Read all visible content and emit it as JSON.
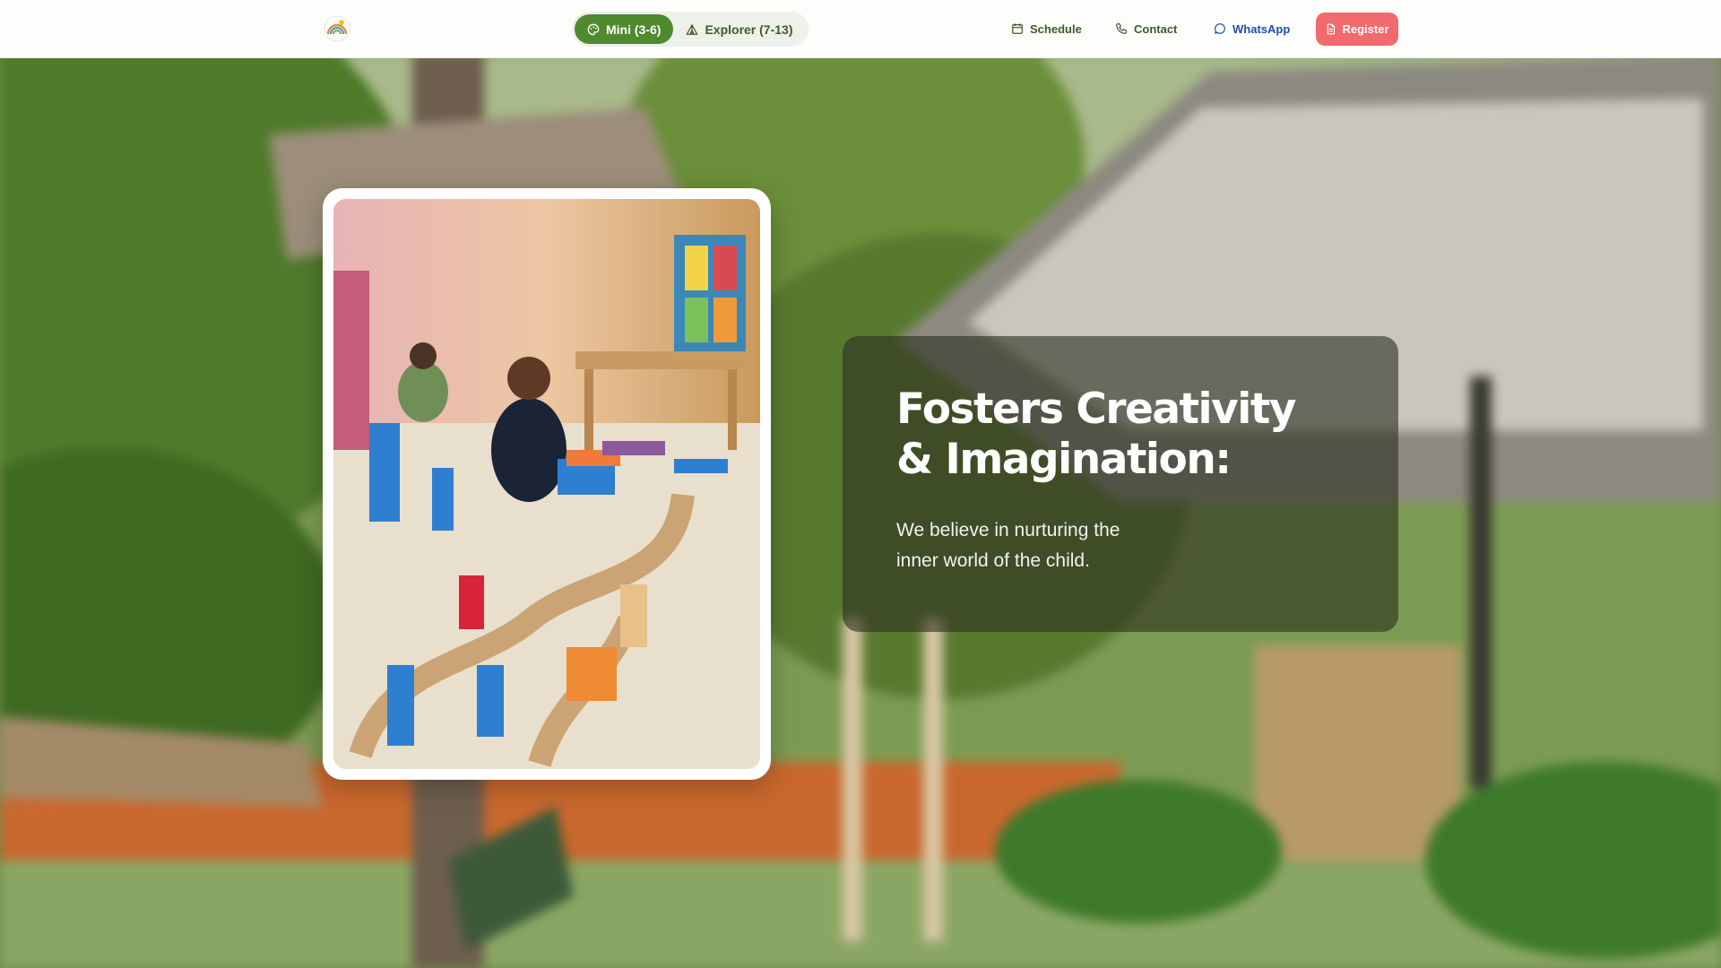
{
  "nav": {
    "logo_icon": "sun-rainbow-logo-icon",
    "programs": [
      {
        "label": "Mini (3-6)",
        "icon": "palette-icon",
        "active": true
      },
      {
        "label": "Explorer (7-13)",
        "icon": "tent-icon",
        "active": false
      }
    ],
    "links": {
      "schedule": "Schedule",
      "contact": "Contact",
      "whatsapp": "WhatsApp"
    },
    "register_label": "Register"
  },
  "hero": {
    "headline_line1": "Fosters Creativity",
    "headline_line2": "& Imagination:",
    "subtext": "We believe in nurturing the inner world of the child."
  },
  "colors": {
    "accent_green": "#4f8a2f",
    "register_red": "#f06a6e",
    "whatsapp_blue": "#1f4fa8"
  }
}
